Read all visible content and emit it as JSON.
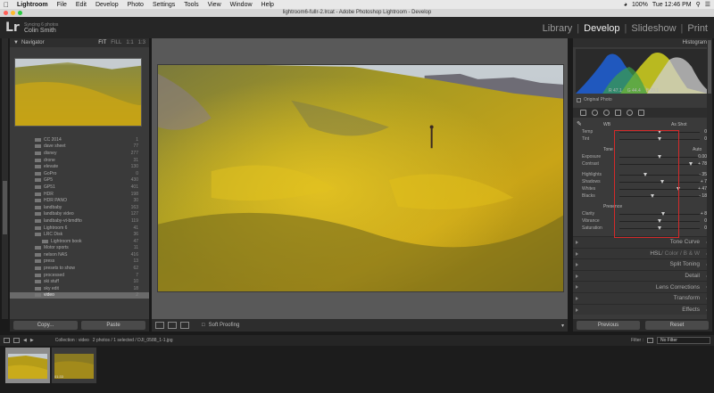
{
  "mac_menu": {
    "app": "Lightroom",
    "items": [
      "File",
      "Edit",
      "Develop",
      "Photo",
      "Settings",
      "Tools",
      "View",
      "Window",
      "Help"
    ],
    "clock": "Tue 12:46 PM",
    "battery": "100%"
  },
  "window": {
    "title": "lightroom6-fullr-2.lrcat - Adobe Photoshop Lightroom - Develop"
  },
  "identity": {
    "logo": "Lr",
    "line1": "Syncing 6 photos",
    "name": "Colin Smith"
  },
  "modules": [
    "Library",
    "Develop",
    "Slideshow",
    "Print"
  ],
  "modules_active": "Develop",
  "navigator": {
    "title": "Navigator",
    "options": [
      "FIT",
      "FILL",
      "1:1",
      "1:3"
    ],
    "selected_option": "FIT"
  },
  "folders": [
    {
      "name": "CC 2014",
      "count": "1"
    },
    {
      "name": "dave sheet",
      "count": "77"
    },
    {
      "name": "disney",
      "count": "277"
    },
    {
      "name": "drone",
      "count": "31"
    },
    {
      "name": "elevate",
      "count": "130"
    },
    {
      "name": "GoPro",
      "count": "0"
    },
    {
      "name": "GP5",
      "count": "430"
    },
    {
      "name": "GP51",
      "count": "401"
    },
    {
      "name": "HDR",
      "count": "198"
    },
    {
      "name": "HDR PANO",
      "count": "30"
    },
    {
      "name": "landbaby",
      "count": "163"
    },
    {
      "name": "landbaby video",
      "count": "127"
    },
    {
      "name": "landbaby-vt-bmdfto",
      "count": "119"
    },
    {
      "name": "Lightroom 6",
      "count": "41"
    },
    {
      "name": "LRC Disk",
      "count": "36"
    },
    {
      "name": "Lightroom book",
      "count": "47"
    },
    {
      "name": "Motor sports",
      "count": "11"
    },
    {
      "name": "nelson NAS",
      "count": "416"
    },
    {
      "name": "press",
      "count": "13"
    },
    {
      "name": "presets to show",
      "count": "62"
    },
    {
      "name": "processed",
      "count": "7"
    },
    {
      "name": "ski stuff",
      "count": "10"
    },
    {
      "name": "sky edit",
      "count": "18"
    },
    {
      "name": "video",
      "count": "2"
    }
  ],
  "left_buttons": {
    "copy": "Copy...",
    "paste": "Paste"
  },
  "toolbar": {
    "soft_proofing": "Soft Proofing"
  },
  "histogram": {
    "title": "Histogram",
    "readout": [
      "R 47.1",
      "G 44.4",
      "B 20.1"
    ],
    "original_photo": "Original Photo"
  },
  "basic": {
    "treatment_left": "WB",
    "treatment_right": "As Shot",
    "tone_label": "Tone",
    "auto_label": "Auto",
    "presence_label": "Presence",
    "sliders": [
      {
        "label": "Temp",
        "value": "0",
        "pos": 0.5
      },
      {
        "label": "Tint",
        "value": "0",
        "pos": 0.5
      },
      {
        "label": "Exposure",
        "value": "0.00",
        "pos": 0.5
      },
      {
        "label": "Contrast",
        "value": "+ 78",
        "pos": 0.89
      },
      {
        "label": "Highlights",
        "value": "- 35",
        "pos": 0.32
      },
      {
        "label": "Shadows",
        "value": "+ 7",
        "pos": 0.53
      },
      {
        "label": "Whites",
        "value": "+ 47",
        "pos": 0.73
      },
      {
        "label": "Blacks",
        "value": "- 18",
        "pos": 0.41
      },
      {
        "label": "Clarity",
        "value": "+ 8",
        "pos": 0.54
      },
      {
        "label": "Vibrance",
        "value": "0",
        "pos": 0.5
      },
      {
        "label": "Saturation",
        "value": "0",
        "pos": 0.5
      }
    ]
  },
  "panels": [
    {
      "label": "Tone Curve"
    },
    {
      "label": "HSL",
      "extra": " / Color / B & W"
    },
    {
      "label": "Split Toning"
    },
    {
      "label": "Detail"
    },
    {
      "label": "Lens Corrections"
    },
    {
      "label": "Transform"
    },
    {
      "label": "Effects"
    }
  ],
  "right_buttons": {
    "previous": "Previous",
    "reset": "Reset"
  },
  "filmstrip_bar": {
    "path": "Collection : video",
    "selection": "2 photos / 1 selected / DJI_0588_1-1.jpg",
    "filter_label": "Filter :",
    "filter_value": "No Filter"
  },
  "filmstrip": [
    {
      "label": "",
      "selected": true
    },
    {
      "label": "01:33",
      "selected": false
    }
  ],
  "colors": {
    "annotation_box": "#d42a2a"
  }
}
